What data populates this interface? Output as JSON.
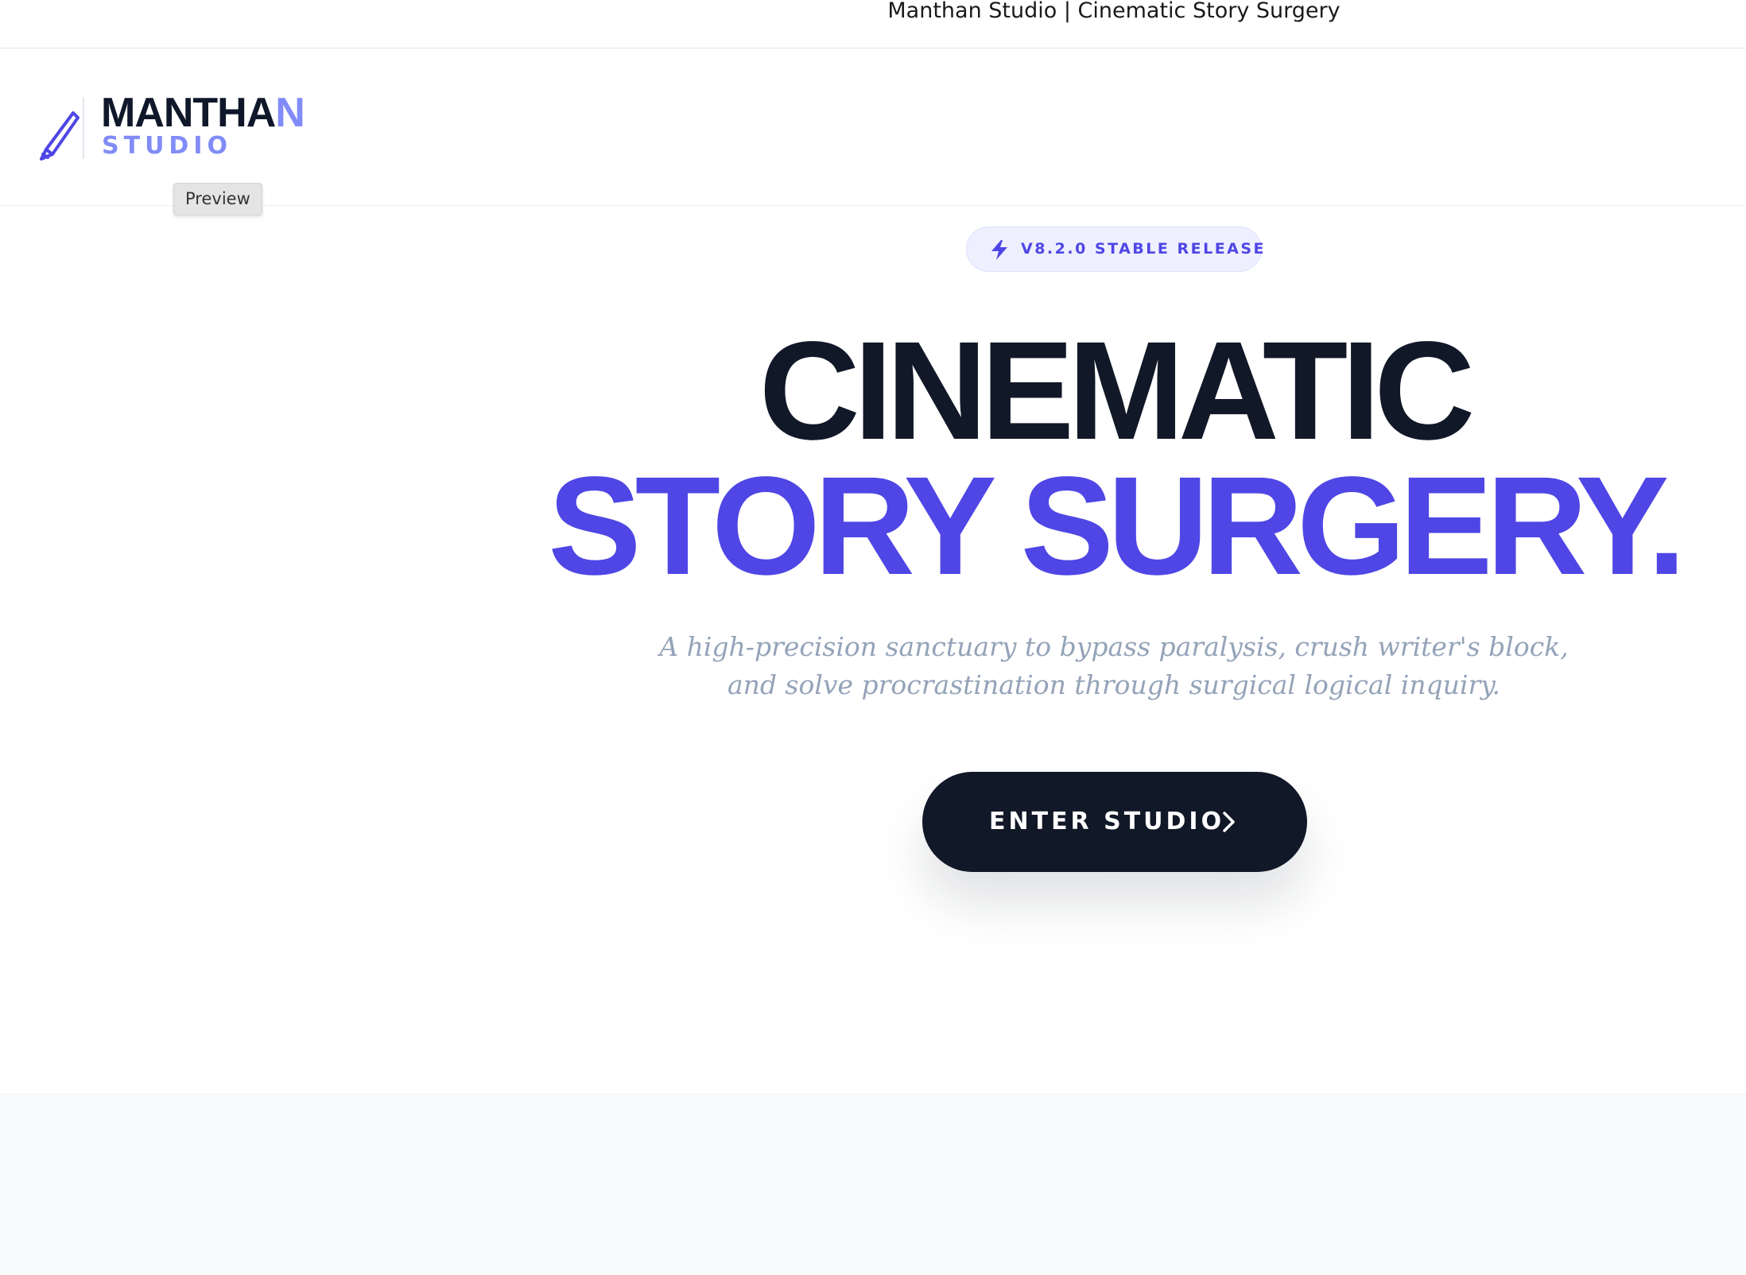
{
  "window": {
    "title": "Manthan Studio | Cinematic Story Surgery"
  },
  "header": {
    "logo_icon": "pen-icon",
    "logo_word_main": "MANTHA",
    "logo_word_accent": "N",
    "logo_sub": "STUDIO",
    "tooltip": "Preview"
  },
  "hero": {
    "badge_icon": "lightning-bolt-icon",
    "badge_text": "V8.2.0 STABLE RELEASE",
    "headline_line1": "CINEMATIC",
    "headline_line2": "STORY SURGERY.",
    "tagline": "A high-precision sanctuary to bypass paralysis, crush writer's block, and solve procrastination through surgical logical inquiry.",
    "cta_label": "ENTER STUDIO",
    "cta_icon": "chevron-right-icon"
  },
  "colors": {
    "brand_indigo": "#4f46e5",
    "brand_indigo_light": "#818cf8",
    "ink": "#111827",
    "muted": "#94a3b8"
  }
}
